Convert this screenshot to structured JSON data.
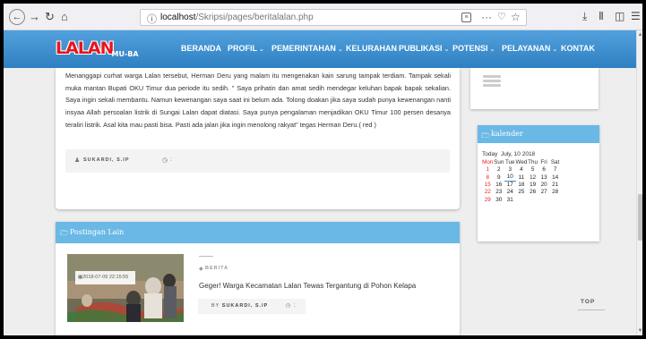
{
  "browser": {
    "url_host": "localhost",
    "url_path": "/Skripsi/pages/beritalalan.php",
    "url_menu": "···"
  },
  "site": {
    "logo_main": "LALAN",
    "logo_sub": "MU-BA",
    "nav": [
      {
        "label": "BERANDA",
        "has_dropdown": false
      },
      {
        "label": "PROFIL",
        "has_dropdown": true
      },
      {
        "label": "PEMERINTAHAN",
        "has_dropdown": true
      },
      {
        "label": "KELURAHAN",
        "has_dropdown": false
      },
      {
        "label": "PUBLIKASI",
        "has_dropdown": true
      },
      {
        "label": "POTENSI",
        "has_dropdown": true
      },
      {
        "label": "PELAYANAN",
        "has_dropdown": true
      },
      {
        "label": "KONTAK",
        "has_dropdown": false
      }
    ]
  },
  "article": {
    "body": "Menanggapi curhat warga Lalan tersebut, Herman Deru yang malam itu mengenakan kain sarung tampak terdiam. Tampak sekali muka mantan Bupati OKU Timur dua periode itu sedih. \" Saya prihatin dan amat sedih mendegar keluhan bapak bapak sekalian. Saya ingin sekali membantu. Namun kewenangan saya saat ini belum ada. Tolong doakan jika saya sudah punya kewenangan nanti insyaa Allah persoalan listrik di Sungai Lalan dapat diatasi. Saya punya pengalaman menjadikan OKU Timur 100 persen desanya teraliri listrik. Asal kita mau pasti bisa. Pasti ada jalan jika ingin menolong rakyat\" tegas Herman Deru.( red )",
    "author": "SUKARDI, S.IP",
    "time_separator": ":"
  },
  "related": {
    "title": "Postingan Lain",
    "items": [
      {
        "date": "2018-07-09 22:15:55",
        "category": "BERITA",
        "title": "Geger! Warga Kecamatan Lalan Tewas Tergantung di Pohon Kelapa",
        "author_prefix": "BY",
        "author": "SUKARDI, S.IP",
        "time_separator": ":"
      }
    ]
  },
  "calendar": {
    "title": "kalender",
    "today_label": "Today",
    "month_label": "July, 10 2018",
    "days": [
      "Mon",
      "Sun",
      "Tue",
      "Wed",
      "Thu",
      "Fri",
      "Sat"
    ],
    "weeks": [
      [
        "1",
        "2",
        "3",
        "4",
        "5",
        "6",
        "7"
      ],
      [
        "8",
        "9",
        "10",
        "11",
        "12",
        "13",
        "14"
      ],
      [
        "15",
        "16",
        "17",
        "18",
        "19",
        "20",
        "21"
      ],
      [
        "22",
        "23",
        "24",
        "25",
        "26",
        "27",
        "28"
      ],
      [
        "29",
        "30",
        "31",
        "",
        "",
        "",
        ""
      ]
    ],
    "highlight_day": "10"
  },
  "footer": {
    "top_label": "TOP"
  },
  "colors": {
    "nav_blue": "#3d8fd0",
    "header_blue": "#6ab8e6",
    "logo_red": "#e8141c",
    "sunday_red": "#ee2222"
  }
}
